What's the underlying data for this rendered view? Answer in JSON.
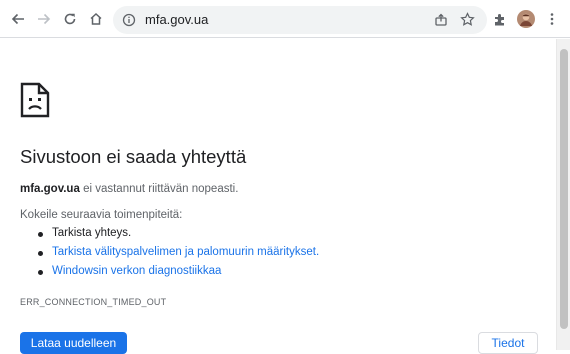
{
  "toolbar": {
    "url": "mfa.gov.ua",
    "icons": [
      "back-icon",
      "forward-icon",
      "reload-icon",
      "home-icon",
      "info-icon",
      "share-icon",
      "star-icon",
      "extensions-icon",
      "avatar",
      "menu-icon"
    ]
  },
  "error_page": {
    "title": "Sivustoon ei saada yhteyttä",
    "host": "mfa.gov.ua",
    "host_message": "ei vastannut riittävän nopeasti.",
    "suggestions_intro": "Kokeile seuraavia toimenpiteitä:",
    "suggestions": [
      {
        "text": "Tarkista yhteys.",
        "link": false
      },
      {
        "text": "Tarkista välityspalvelimen ja palomuurin määritykset.",
        "link": true
      },
      {
        "text": "Windowsin verkon diagnostiikkaa",
        "link": true
      }
    ],
    "error_code": "ERR_CONNECTION_TIMED_OUT",
    "reload_label": "Lataa uudelleen",
    "details_label": "Tiedot"
  },
  "colors": {
    "accent": "#1a73e8",
    "text": "#202124",
    "secondary_text": "#5f6368"
  }
}
